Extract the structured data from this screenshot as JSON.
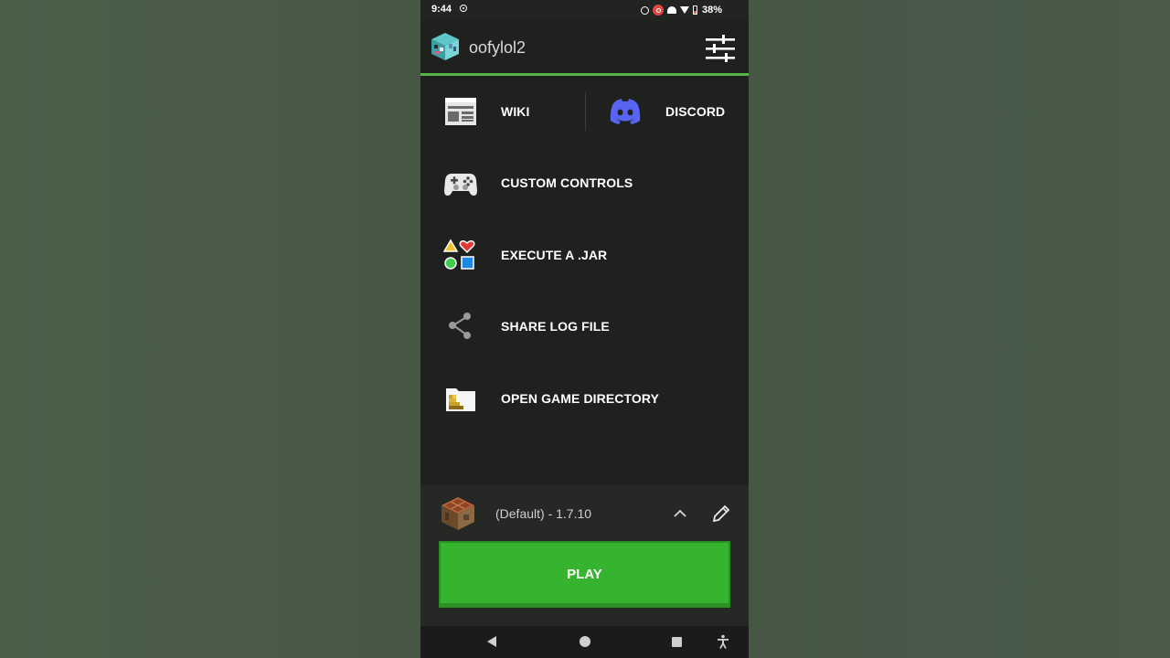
{
  "status_bar": {
    "time": "9:44",
    "battery": "38%"
  },
  "header": {
    "username": "oofylol2"
  },
  "menu": {
    "wiki": "WIKI",
    "discord": "DISCORD",
    "custom_controls": "CUSTOM CONTROLS",
    "execute_jar": "EXECUTE A .JAR",
    "share_log": "SHARE LOG FILE",
    "open_dir": "OPEN GAME DIRECTORY"
  },
  "profile": {
    "version_label": "(Default) - 1.7.10"
  },
  "play_button": {
    "label": "PLAY"
  },
  "colors": {
    "accent": "#57b54a",
    "play": "#36b42f",
    "discord": "#5865f2",
    "background": "#1f211f"
  }
}
